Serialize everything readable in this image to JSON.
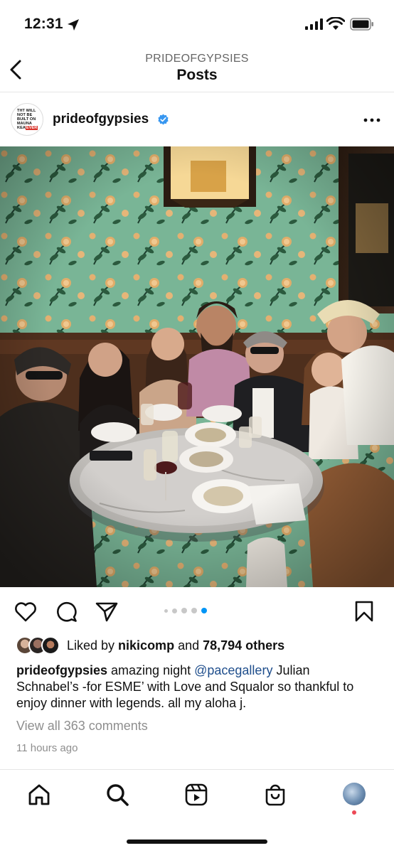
{
  "status_bar": {
    "time": "12:31"
  },
  "header": {
    "subtitle": "PRIDEOFGYPSIES",
    "title": "Posts"
  },
  "post": {
    "username": "prideofgypsies",
    "avatar_text": [
      "THT WILL",
      "NOT BE",
      "BUILT ON",
      "MAUNA",
      "KEA",
      "EVER"
    ],
    "carousel": {
      "count": 5,
      "active": 5
    },
    "likes": {
      "prefix": "Liked by ",
      "user": "nikicomp",
      "middle": " and ",
      "count_text": "78,794 others"
    },
    "caption": {
      "username": "prideofgypsies",
      "before_mention": " amazing night ",
      "mention": "@pacegallery",
      "after_mention": " Julian Schnabel’s -for ESME’ with Love and Squalor  so thankful to enjoy dinner with legends.  all my aloha j."
    },
    "view_comments": "View all 363 comments",
    "time_ago": "11 hours ago"
  },
  "icons": {
    "status": [
      "location-arrow-icon",
      "signal-icon",
      "wifi-icon",
      "battery-icon"
    ],
    "header": [
      "back-icon",
      "verified-icon",
      "more-icon"
    ],
    "actions": [
      "heart-icon",
      "comment-icon",
      "share-icon",
      "bookmark-icon"
    ],
    "tabs": [
      "home-icon",
      "search-icon",
      "reels-icon",
      "shop-icon",
      "profile-avatar"
    ]
  },
  "colors": {
    "mention": "#1f4e8c",
    "verified": "#3897f0",
    "carousel_active": "#0095f6",
    "notification": "#ed4956",
    "wallpaper": "#7fb79a"
  }
}
